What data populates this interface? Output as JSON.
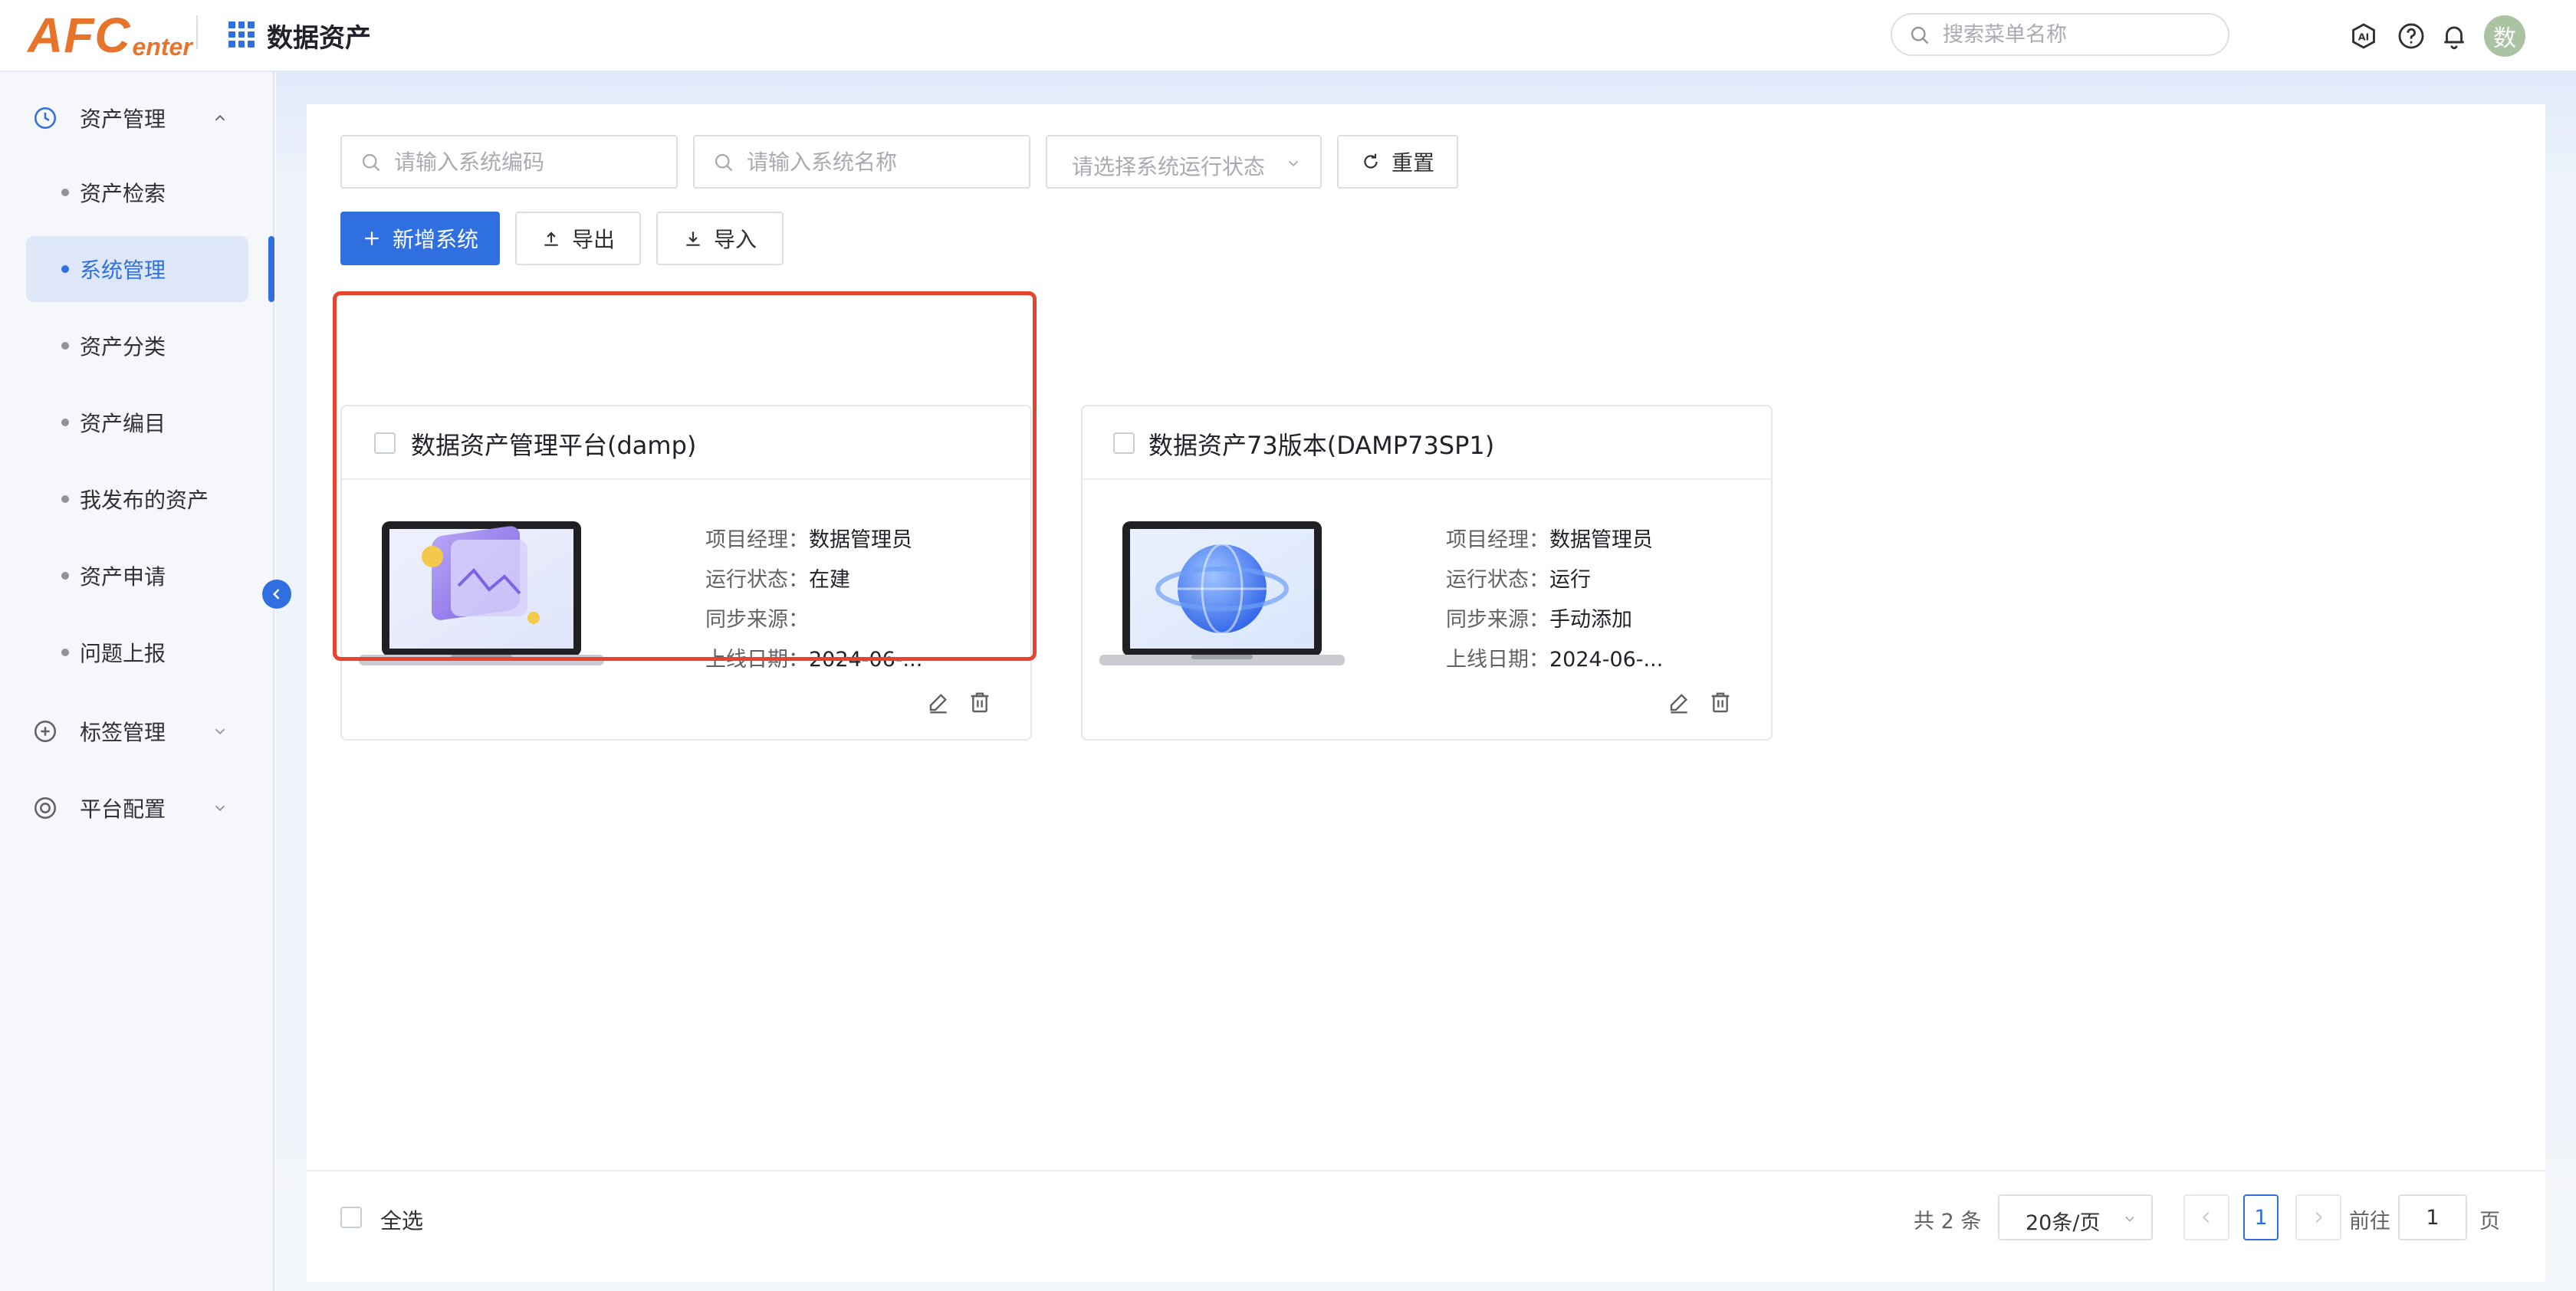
{
  "header": {
    "logo_main": "AFC",
    "logo_sub": "enter",
    "app_title": "数据资产",
    "search_placeholder": "搜索菜单名称",
    "avatar_text": "数"
  },
  "sidebar": {
    "groups": [
      {
        "label": "资产管理",
        "expanded": true,
        "icon": "clock-icon"
      },
      {
        "label": "标签管理",
        "expanded": false,
        "icon": "plus-circle-icon"
      },
      {
        "label": "平台配置",
        "expanded": false,
        "icon": "target-icon"
      }
    ],
    "items": [
      {
        "label": "资产检索"
      },
      {
        "label": "系统管理",
        "active": true
      },
      {
        "label": "资产分类"
      },
      {
        "label": "资产编目"
      },
      {
        "label": "我发布的资产"
      },
      {
        "label": "资产申请"
      },
      {
        "label": "问题上报"
      }
    ]
  },
  "filters": {
    "code_placeholder": "请输入系统编码",
    "name_placeholder": "请输入系统名称",
    "status_placeholder": "请选择系统运行状态",
    "reset_label": "重置"
  },
  "toolbar": {
    "add_label": "新增系统",
    "export_label": "导出",
    "import_label": "导入"
  },
  "cards": [
    {
      "title": "数据资产管理平台(damp)",
      "manager_key": "项目经理：",
      "manager": "数据管理员",
      "status_key": "运行状态：",
      "status": "在建",
      "source_key": "同步来源：",
      "source": "",
      "date_key": "上线日期：",
      "date": "2024-06-..."
    },
    {
      "title": "数据资产73版本(DAMP73SP1)",
      "manager_key": "项目经理：",
      "manager": "数据管理员",
      "status_key": "运行状态：",
      "status": "运行",
      "source_key": "同步来源：",
      "source": "手动添加",
      "date_key": "上线日期：",
      "date": "2024-06-..."
    }
  ],
  "footer": {
    "select_all": "全选",
    "total": "共 2 条",
    "page_size": "20条/页",
    "current_page": "1",
    "goto_label": "前往",
    "goto_value": "1",
    "goto_suffix": "页"
  },
  "colors": {
    "primary": "#2f6fe0",
    "logo": "#e8732a",
    "highlight": "#e8432e"
  }
}
